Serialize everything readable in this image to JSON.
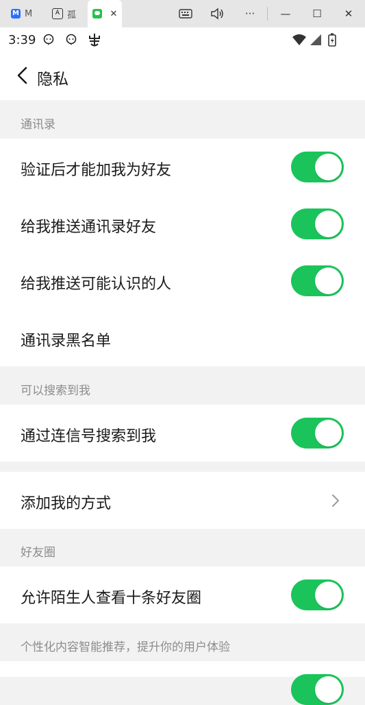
{
  "titlebar": {
    "tabs": [
      {
        "label": "M",
        "icon": "m-logo-icon"
      },
      {
        "label": "孤",
        "icon": "a-logo-icon"
      },
      {
        "label": "",
        "icon": "chat-logo-icon",
        "close": "✕"
      }
    ],
    "controls": {
      "more": "···",
      "minimize": "—",
      "maximize": "☐",
      "close": "✕"
    }
  },
  "statusbar": {
    "time": "3:39"
  },
  "header": {
    "title": "隐私"
  },
  "sections": {
    "contacts": {
      "label": "通讯录",
      "rows": [
        {
          "label": "验证后才能加我为好友",
          "on": true
        },
        {
          "label": "给我推送通讯录好友",
          "on": true
        },
        {
          "label": "给我推送可能认识的人",
          "on": true
        },
        {
          "label": "通讯录黑名单"
        }
      ]
    },
    "search": {
      "label": "可以搜索到我",
      "rows": [
        {
          "label": "通过连信号搜索到我",
          "on": true
        }
      ]
    },
    "add_methods": {
      "rows": [
        {
          "label": "添加我的方式"
        }
      ]
    },
    "moments": {
      "label": "好友圈",
      "rows": [
        {
          "label": "允许陌生人查看十条好友圈",
          "on": true
        }
      ]
    },
    "personalized": {
      "label": "个性化内容智能推荐，提升你的用户体验"
    }
  },
  "colors": {
    "toggle_on": "#1bc45b",
    "background": "#f2f2f2"
  }
}
